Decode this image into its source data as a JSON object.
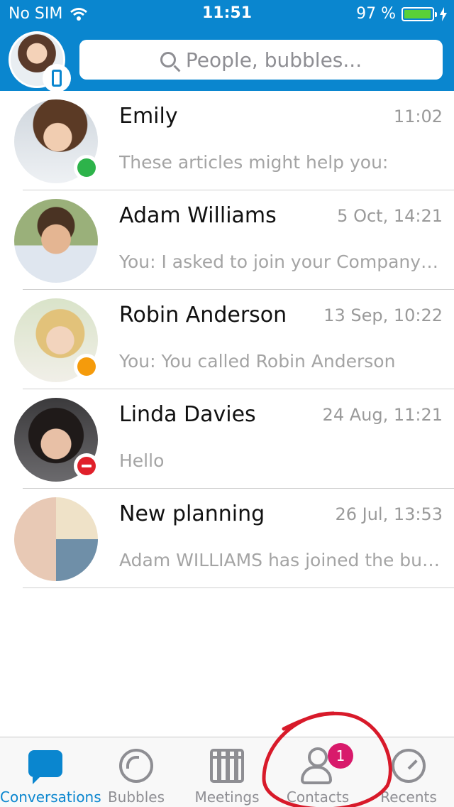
{
  "status_bar": {
    "carrier": "No SIM",
    "time": "11:51",
    "battery": "97 %",
    "battery_level": 0.97
  },
  "search": {
    "placeholder": "People, bubbles..."
  },
  "conversations": [
    {
      "name": "Emily",
      "time": "11:02",
      "preview": "These articles might help you:",
      "presence": "online",
      "presence_color": "#2db34a"
    },
    {
      "name": "Adam Williams",
      "time": "5 Oct, 14:21",
      "preview": "You: I asked to join your Company 🙂",
      "presence": "none"
    },
    {
      "name": "Robin Anderson",
      "time": "13 Sep, 10:22",
      "preview": "You: You called Robin Anderson",
      "presence": "away",
      "presence_color": "#f59b0b"
    },
    {
      "name": "Linda Davies",
      "time": "24 Aug, 11:21",
      "preview": "Hello",
      "presence": "do-not-disturb",
      "presence_color": "#e0202a"
    },
    {
      "name": "New planning",
      "time": "26 Jul, 13:53",
      "preview": " Adam WILLIAMS has joined the bubble",
      "presence": "none"
    }
  ],
  "tabs": [
    {
      "label": "Conversations",
      "icon": "chat-bubble-icon",
      "active": true
    },
    {
      "label": "Bubbles",
      "icon": "bubbles-icon",
      "active": false
    },
    {
      "label": "Meetings",
      "icon": "calendar-icon",
      "active": false
    },
    {
      "label": "Contacts",
      "icon": "contacts-icon",
      "active": false,
      "badge": "1"
    },
    {
      "label": "Recents",
      "icon": "clock-icon",
      "active": false
    }
  ],
  "colors": {
    "header": "#0a86cf",
    "accent": "#0a86cf",
    "badge": "#d81a6b",
    "annotation": "#d81a2a"
  }
}
